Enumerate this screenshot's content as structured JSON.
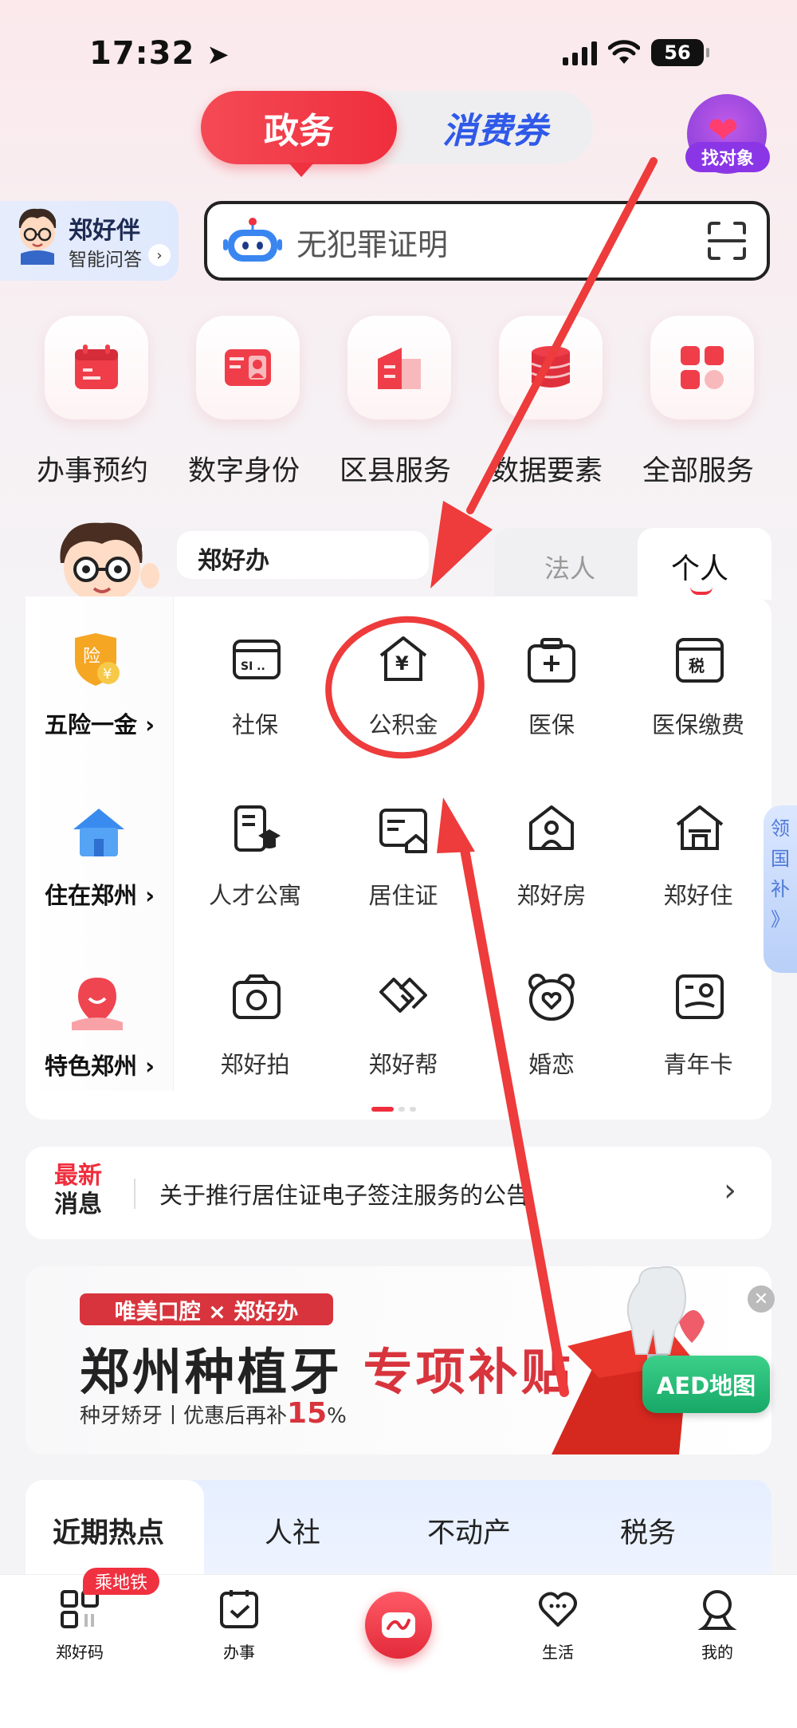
{
  "status_bar": {
    "time": "17:32",
    "battery": "56"
  },
  "header": {
    "tabs": [
      {
        "label": "政务",
        "active": true
      },
      {
        "label": "消费券",
        "active": false
      }
    ],
    "match_badge_label": "找对象"
  },
  "assistant": {
    "name": "郑好伴",
    "subtitle": "智能问答"
  },
  "search": {
    "placeholder": "无犯罪证明"
  },
  "quick_services": [
    {
      "label": "办事预约",
      "icon": "calendar-icon"
    },
    {
      "label": "数字身份",
      "icon": "id-card-icon"
    },
    {
      "label": "区县服务",
      "icon": "building-icon"
    },
    {
      "label": "数据要素",
      "icon": "database-icon"
    },
    {
      "label": "全部服务",
      "icon": "grid-icon"
    }
  ],
  "services": {
    "title": "郑好办",
    "tabs": [
      {
        "label": "法人",
        "active": false
      },
      {
        "label": "个人",
        "active": true
      }
    ],
    "categories": [
      {
        "label": "五险一金",
        "icon": "insurance-shield-icon"
      },
      {
        "label": "住在郑州",
        "icon": "house-icon"
      },
      {
        "label": "特色郑州",
        "icon": "location-icon"
      }
    ],
    "rows": [
      [
        {
          "label": "社保",
          "icon": "social-security-card-icon"
        },
        {
          "label": "公积金",
          "icon": "housing-fund-icon"
        },
        {
          "label": "医保",
          "icon": "medical-kit-icon"
        },
        {
          "label": "医保缴费",
          "icon": "tax-payment-icon"
        }
      ],
      [
        {
          "label": "人才公寓",
          "icon": "talent-apartment-icon"
        },
        {
          "label": "居住证",
          "icon": "residence-permit-icon"
        },
        {
          "label": "郑好房",
          "icon": "house-person-icon"
        },
        {
          "label": "郑好住",
          "icon": "home-icon"
        }
      ],
      [
        {
          "label": "郑好拍",
          "icon": "camera-icon"
        },
        {
          "label": "郑好帮",
          "icon": "handshake-icon"
        },
        {
          "label": "婚恋",
          "icon": "bear-heart-icon"
        },
        {
          "label": "青年卡",
          "icon": "youth-card-icon"
        }
      ]
    ],
    "side_tab": [
      "领",
      "国",
      "补",
      "》"
    ]
  },
  "news": {
    "tag_line1": "最新",
    "tag_line2": "消息",
    "text": "关于推行居住证电子签注服务的公告"
  },
  "banner": {
    "tag": "唯美口腔 × 郑好办",
    "title_main": "郑州种植牙 ",
    "title_accent": "专项补贴",
    "subtitle_prefix": "种牙矫牙丨优惠后再补",
    "subtitle_percent": "15",
    "subtitle_suffix": "%",
    "aed_label": "AED地图"
  },
  "hot_tabs": [
    {
      "label": "近期热点",
      "active": true
    },
    {
      "label": "人社",
      "active": false
    },
    {
      "label": "不动产",
      "active": false
    },
    {
      "label": "税务",
      "active": false
    }
  ],
  "bottom_nav": {
    "metro_badge": "乘地铁",
    "items": [
      {
        "label": "郑好码",
        "icon": "qr-code-icon"
      },
      {
        "label": "办事",
        "icon": "checklist-icon"
      },
      {
        "label": "",
        "icon": "home-center-icon"
      },
      {
        "label": "生活",
        "icon": "heart-chat-icon"
      },
      {
        "label": "我的",
        "icon": "user-icon"
      }
    ]
  },
  "colors": {
    "brand_red": "#ef2e3d",
    "blue_accent": "#2f59e8",
    "annotation_red": "#ee3b3b"
  }
}
